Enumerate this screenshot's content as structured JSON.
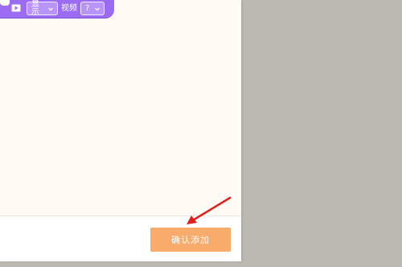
{
  "block": {
    "icon": "video-icon",
    "display_select": "显示",
    "label": "视频",
    "question_select": "?"
  },
  "footer": {
    "confirm_label": "确认添加"
  },
  "annotation": {
    "type": "red-arrow",
    "color": "#e02020"
  },
  "colors": {
    "block": "#9b6cf2",
    "button": "#f8ab6b",
    "backdrop": "#bcb9b1"
  }
}
